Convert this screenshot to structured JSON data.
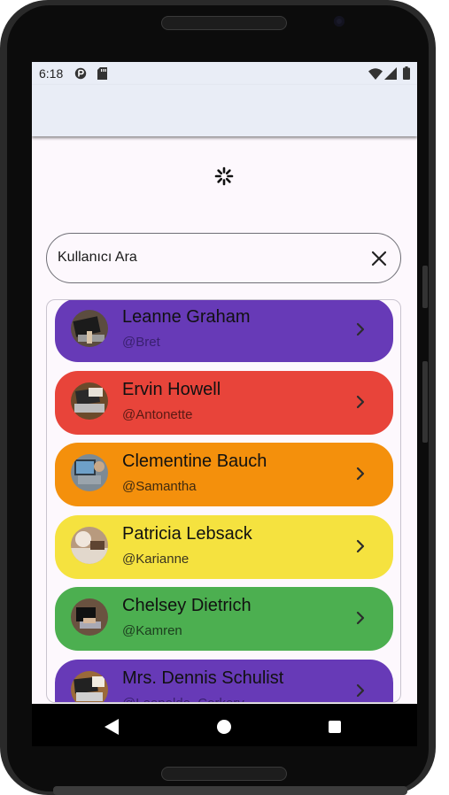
{
  "status_bar": {
    "time": "6:18",
    "left_icons": [
      "sync-icon",
      "sd-card-icon"
    ],
    "right_icons": [
      "wifi-icon",
      "signal-icon",
      "battery-icon"
    ]
  },
  "loader": {
    "icon": "spinner-icon"
  },
  "search": {
    "value": "Kullanıcı Ara",
    "clear_icon": "close-icon"
  },
  "users": [
    {
      "name": "Leanne Graham",
      "handle": "@Bret",
      "color": "#673ab7",
      "handle_color": "#3a2070"
    },
    {
      "name": "Ervin Howell",
      "handle": "@Antonette",
      "color": "#e8443a",
      "handle_color": "#5a1a14"
    },
    {
      "name": "Clementine Bauch",
      "handle": "@Samantha",
      "color": "#f4900c",
      "handle_color": "#3f2a10"
    },
    {
      "name": "Patricia Lebsack",
      "handle": "@Karianne",
      "color": "#f5e23f",
      "handle_color": "#3b3520"
    },
    {
      "name": "Chelsey Dietrich",
      "handle": "@Kamren",
      "color": "#4caf50",
      "handle_color": "#1c3d1e"
    },
    {
      "name": "Mrs. Dennis Schulist",
      "handle": "@Leopoldo_Corkery",
      "color": "#673ab7",
      "handle_color": "#3a2070"
    }
  ],
  "nav": {
    "back_icon": "back-triangle-icon",
    "home_icon": "home-circle-icon",
    "recents_icon": "recents-square-icon"
  }
}
